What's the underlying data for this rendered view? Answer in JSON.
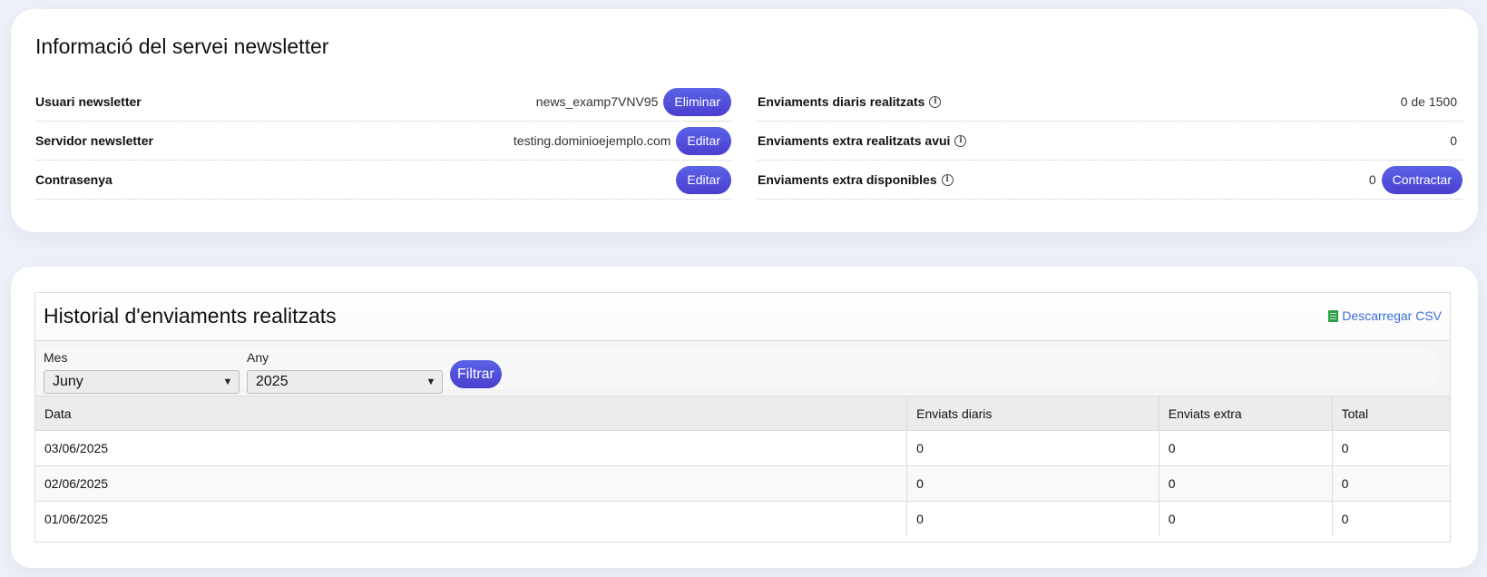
{
  "service_info": {
    "title": "Informació del servei newsletter",
    "left_rows": [
      {
        "label": "Usuari newsletter",
        "value": "news_examp7VNV95",
        "button": "Eliminar"
      },
      {
        "label": "Servidor newsletter",
        "value": "testing.dominioejemplo.com",
        "button": "Editar"
      },
      {
        "label": "Contrasenya",
        "value": "",
        "button": "Editar"
      }
    ],
    "right_rows": [
      {
        "label": "Enviaments diaris realitzats",
        "value": "0 de 1500",
        "button": ""
      },
      {
        "label": "Enviaments extra realitzats avui",
        "value": "0",
        "button": ""
      },
      {
        "label": "Enviaments extra disponibles",
        "value": "0",
        "button": "Contractar"
      }
    ],
    "info_icon": "info-circle-icon"
  },
  "history": {
    "title": "Historial d'enviaments realitzats",
    "csv_link": "Descarregar CSV",
    "csv_icon": "spreadsheet-icon",
    "filters": {
      "month_label": "Mes",
      "month_value": "Juny",
      "year_label": "Any",
      "year_value": "2025",
      "button": "Filtrar"
    },
    "columns": [
      "Data",
      "Enviats diaris",
      "Enviats extra",
      "Total"
    ],
    "rows": [
      [
        "03/06/2025",
        "0",
        "0",
        "0"
      ],
      [
        "02/06/2025",
        "0",
        "0",
        "0"
      ],
      [
        "01/06/2025",
        "0",
        "0",
        "0"
      ]
    ]
  },
  "colors": {
    "accent": "#4f50dc",
    "link": "#3c6fd8",
    "csv_icon": "#2e9d4a"
  }
}
